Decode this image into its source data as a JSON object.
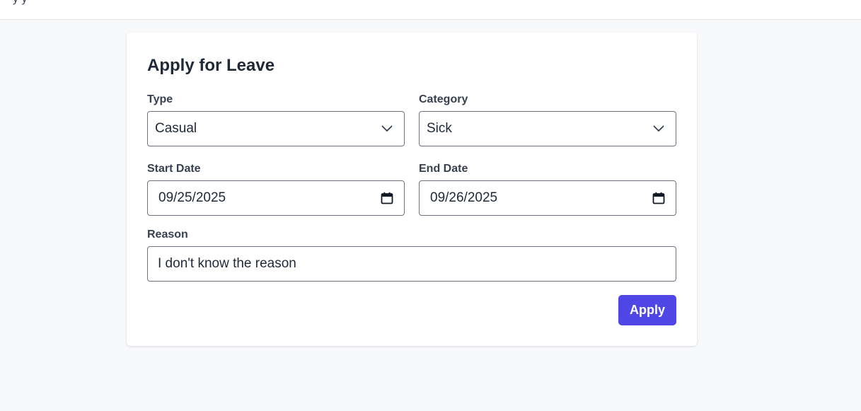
{
  "header": {
    "partial_text": "y  y"
  },
  "form": {
    "title": "Apply for Leave",
    "type": {
      "label": "Type",
      "value": "Casual",
      "icon": "chevron-down-icon"
    },
    "category": {
      "label": "Category",
      "value": "Sick",
      "icon": "chevron-down-icon"
    },
    "start_date": {
      "label": "Start Date",
      "value": "09/25/2025",
      "icon": "calendar-icon"
    },
    "end_date": {
      "label": "End Date",
      "value": "09/26/2025",
      "icon": "calendar-icon"
    },
    "reason": {
      "label": "Reason",
      "value": "I don't know the reason"
    },
    "apply_label": "Apply"
  },
  "colors": {
    "primary": "#4f46e5",
    "background": "#f8f9fb",
    "card": "#ffffff",
    "border": "#6b7280"
  }
}
